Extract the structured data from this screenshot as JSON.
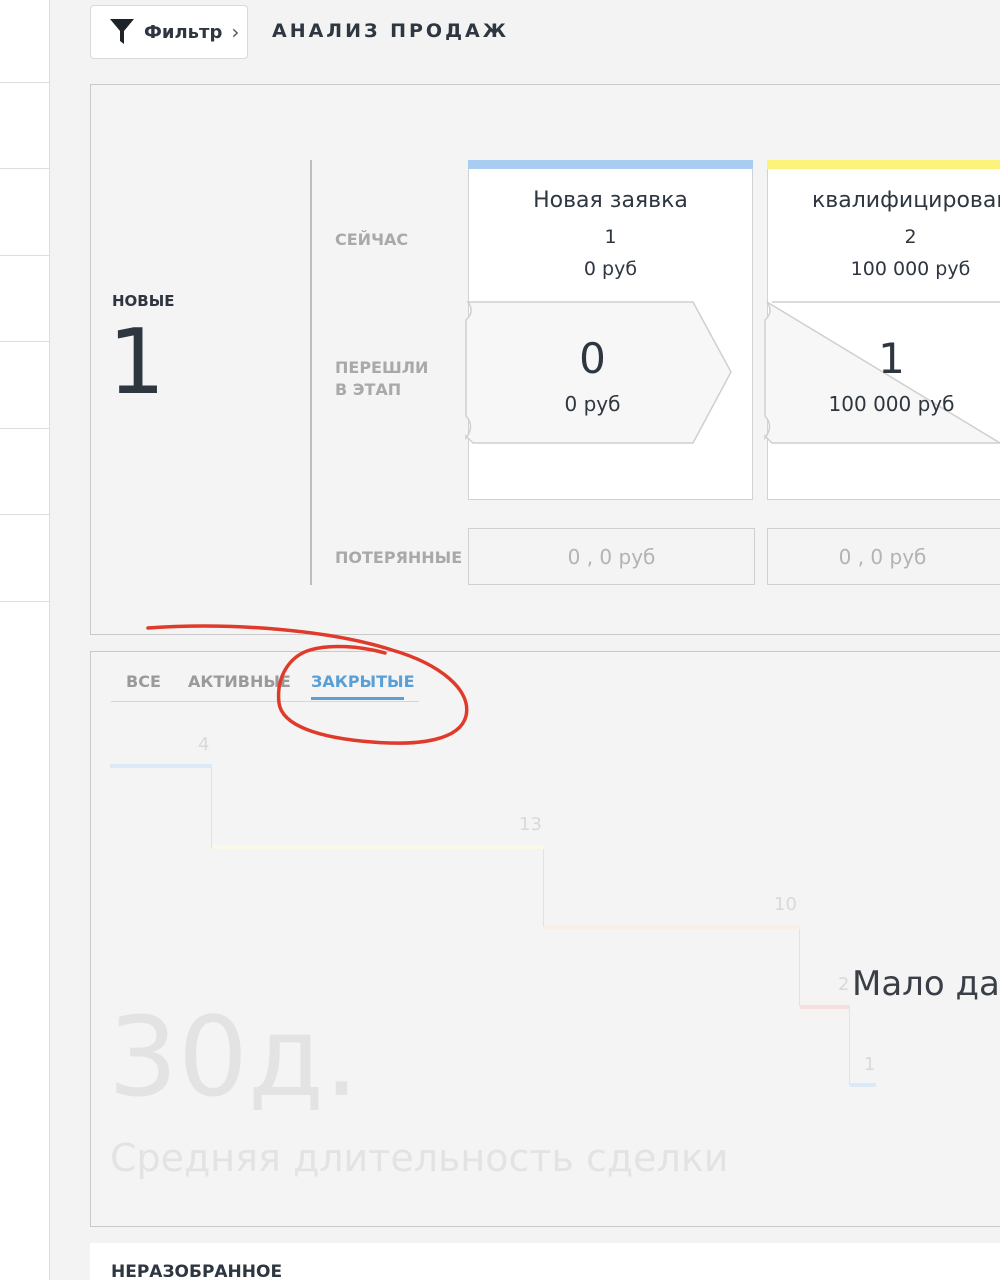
{
  "toolbar": {
    "filter_label": "Фильтр",
    "filter_icon": "funnel-icon",
    "chevron": "›",
    "page_title": "АНАЛИЗ ПРОДАЖ"
  },
  "summary": {
    "new_label": "НОВЫЕ",
    "new_count": "1"
  },
  "row_labels": {
    "now": "СЕЙЧАС",
    "moved_line1": "ПЕРЕШЛИ",
    "moved_line2": "В ЭТАП",
    "lost": "ПОТЕРЯННЫЕ"
  },
  "stages": [
    {
      "name": "Новая заявка",
      "count": "1",
      "sum": "0 руб",
      "moved_count": "0",
      "moved_sum": "0 руб",
      "lost": "0 , 0 руб",
      "color": "#a8cdf0"
    },
    {
      "name": "квалифицирован",
      "count": "2",
      "sum": "100 000 руб",
      "moved_count": "1",
      "moved_sum": "100 000 руб",
      "lost": "0 , 0 руб",
      "color": "#fdf27a"
    }
  ],
  "tabs": {
    "all": "ВСЕ",
    "active": "АКТИВНЫЕ",
    "closed": "ЗАКРЫТЫЕ",
    "selected": "closed",
    "accent": "#5aa0d6"
  },
  "duration_chart": {
    "steps": [
      "4",
      "13",
      "10",
      "2",
      "1"
    ],
    "average_days": "30д.",
    "average_caption": "Средняя длительность сделки",
    "few_data": "Мало дан"
  },
  "annotation_color": "#e03a2a",
  "bottom": {
    "title": "НЕРАЗОБРАННОЕ"
  }
}
